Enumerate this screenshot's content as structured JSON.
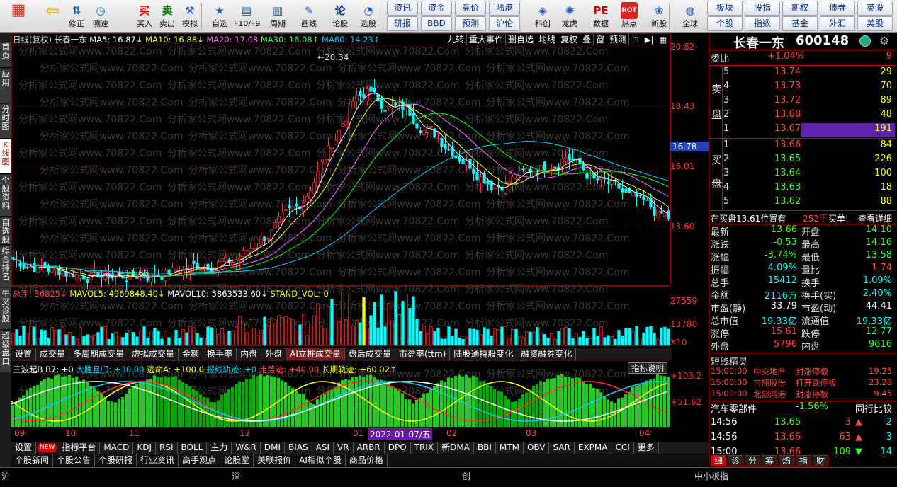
{
  "toolbar": {
    "buttons": [
      {
        "label": "",
        "icon": "home-grid-icon"
      },
      {
        "label": "",
        "icon": "back-arrow-icon"
      },
      {
        "label": "修正",
        "icon": "up-down-icon"
      },
      {
        "label": "测速",
        "icon": "clock-icon"
      },
      {
        "label": "买入",
        "icon": "buy-icon",
        "glyph": "买"
      },
      {
        "label": "卖出",
        "icon": "sell-icon",
        "glyph": "卖"
      },
      {
        "label": "模拟",
        "icon": "gavel-icon"
      },
      {
        "label": "自选",
        "icon": "favorites-icon"
      },
      {
        "label": "F10/F9",
        "icon": "f10-icon"
      },
      {
        "label": "周期",
        "icon": "period-icon"
      },
      {
        "label": "画线",
        "icon": "pen-icon"
      },
      {
        "label": "论股",
        "icon": "discuss-icon",
        "glyph": "论"
      },
      {
        "label": "选股",
        "icon": "select-stock-icon"
      },
      {
        "label": "科创",
        "icon": "kechuang-icon"
      },
      {
        "label": "龙虎",
        "icon": "dragon-tiger-icon"
      },
      {
        "label": "数据",
        "icon": "data-pe-icon",
        "glyph": "PE"
      },
      {
        "label": "热点",
        "icon": "hot-icon",
        "glyph": "HOT"
      },
      {
        "label": "新股",
        "icon": "new-stock-icon"
      },
      {
        "label": "全球",
        "icon": "globe-icon"
      }
    ],
    "mid_buttons": [
      "资讯",
      "资金",
      "竞价",
      "陆港",
      "研报",
      "BBD",
      "预测",
      "沪伦"
    ],
    "right_buttons": [
      "板块",
      "股指",
      "期权",
      "债券",
      "英股",
      "个股",
      "指数",
      "基金",
      "外汇",
      "美股"
    ]
  },
  "left_nav": [
    "首页",
    "应用",
    "分时图",
    "K线图",
    "个股资料",
    "自选股",
    "综合排名",
    "牛叉诊股",
    "超级盘口"
  ],
  "kline": {
    "legend": {
      "name": "日线(复权) 长春一东",
      "ma5": "MA5: 16.87↓",
      "ma10": "MA10: 16.88↓",
      "ma20": "MA20: 17.08",
      "ma30": "MA30: 16.08↑",
      "ma60": "MA60: 14.23↑"
    },
    "tools": [
      "九转",
      "重大事件",
      "删自选",
      "均线",
      "复权",
      "叠",
      "窗",
      "预测"
    ],
    "axis_labels": [
      "20.82",
      "18.43",
      "16.78",
      "16.01",
      "13.60"
    ],
    "current_price": "16.78",
    "high_label": "20.34",
    "low_label": "11.66",
    "watermark": "分析家公式网www.70822.Com",
    "colors": {
      "ma5": "#ffffff",
      "ma10": "#ffff00",
      "ma20": "#ff66ff",
      "ma30": "#00ff00",
      "ma60": "#00ccff",
      "up": "#ff3333",
      "down": "#00ffff"
    }
  },
  "volume": {
    "legend": {
      "total": "总手: 36825↓",
      "mavol5": "MAVOL5: 4969848.40↓",
      "mavol10": "MAVOL10: 5863533.60↓",
      "standvol": "STAND_VOL: 0"
    },
    "axis_labels": [
      "27559",
      "13780",
      "X10"
    ]
  },
  "sub_tabs": [
    "设置",
    "成交量",
    "多周期成交量",
    "虚拟成交量",
    "金额",
    "换手率",
    "内盘",
    "外盘",
    "AI立桩成交量",
    "盘后成交量",
    "市盈率(ttm)",
    "陆股通持股变化",
    "融资融券变化"
  ],
  "indicator": {
    "legend": {
      "name": "三波起B B7: +0",
      "dsqg": "大胜且归: +30.00",
      "tma": "逃命A: +100.0",
      "bxgj": "报线轨迹: +0",
      "zsj": "走势迹: +40.00",
      "cqgj": "长期轨迹: +60.02↑"
    },
    "button": "指标说明",
    "axis_labels": [
      "+103.2",
      "+51.62"
    ]
  },
  "months": [
    "09",
    "10",
    "11",
    "12",
    "01",
    "02",
    "03",
    "04"
  ],
  "date_marker": "2022-01-07/五",
  "indicator_tabs": [
    "设置",
    "NEW",
    "指标平台",
    "MACD",
    "KDJ",
    "RSI",
    "BOLL",
    "主力",
    "W&R",
    "DMI",
    "BIAS",
    "ASI",
    "VR",
    "ARBR",
    "DPO",
    "TRIX",
    "新DMA",
    "BBI",
    "MTM",
    "OBV",
    "SAR",
    "EXPMA",
    "CCI",
    "更多"
  ],
  "bottom_tabs": [
    "个股新闻",
    "个股公告",
    "个股研报",
    "行业资讯",
    "高手观点",
    "论股堂",
    "关联报价",
    "AI相似个股",
    "商品价格"
  ],
  "panel": {
    "stock_name": "长春一东",
    "stock_code": "600148",
    "weibi_label": "委比",
    "weibi_value": "+1.04%",
    "weibi_extra": "9",
    "sell_label": [
      "卖",
      "盘"
    ],
    "buy_label": [
      "买",
      "盘"
    ],
    "sell": [
      {
        "lvl": "5",
        "price": "13.74",
        "vol": "29"
      },
      {
        "lvl": "4",
        "price": "13.73",
        "vol": "70"
      },
      {
        "lvl": "3",
        "price": "13.72",
        "vol": "89"
      },
      {
        "lvl": "2",
        "price": "13.68",
        "vol": "48"
      },
      {
        "lvl": "1",
        "price": "13.67",
        "vol": "191"
      }
    ],
    "buy": [
      {
        "lvl": "1",
        "price": "13.66",
        "vol": "84"
      },
      {
        "lvl": "2",
        "price": "13.65",
        "vol": "226"
      },
      {
        "lvl": "3",
        "price": "13.64",
        "vol": "100"
      },
      {
        "lvl": "4",
        "price": "13.63",
        "vol": "18"
      },
      {
        "lvl": "5",
        "price": "13.62",
        "vol": "88"
      }
    ],
    "buy_notice": {
      "text": "在买盘13.61位置有",
      "qty": "252手",
      "tag": "买单!",
      "link": "查看详细"
    },
    "stats": [
      {
        "l1": "最新",
        "v1": "13.66",
        "c1": "grn",
        "l2": "开盘",
        "v2": "14.10",
        "c2": "grn"
      },
      {
        "l1": "涨跌",
        "v1": "-0.53",
        "c1": "grn",
        "l2": "最高",
        "v2": "14.16",
        "c2": "grn"
      },
      {
        "l1": "涨幅",
        "v1": "-3.74%",
        "c1": "grn",
        "l2": "最低",
        "v2": "13.58",
        "c2": "grn"
      },
      {
        "l1": "振幅",
        "v1": "4.09%",
        "c1": "cyn",
        "l2": "量比",
        "v2": "1.74",
        "c2": "red"
      },
      {
        "l1": "总手",
        "v1": "15412",
        "c1": "cyn",
        "l2": "换手",
        "v2": "1.09%",
        "c2": "cyn"
      },
      {
        "l1": "金额",
        "v1": "2116万",
        "c1": "cyn",
        "l2": "换手(实)",
        "v2": "2.40%",
        "c2": "cyn"
      },
      {
        "l1": "市盈(静)",
        "v1": "33.79",
        "c1": "wht",
        "l2": "市盈(动)",
        "v2": "44.41",
        "c2": "wht"
      },
      {
        "l1": "总市值",
        "v1": "19.33亿",
        "c1": "cyn",
        "l2": "流通值",
        "v2": "19.33亿",
        "c2": "cyn"
      },
      {
        "l1": "涨停",
        "v1": "15.61",
        "c1": "red",
        "l2": "跌停",
        "v2": "12.77",
        "c2": "grn"
      },
      {
        "l1": "外盘",
        "v1": "5796",
        "c1": "red",
        "l2": "内盘",
        "v2": "9616",
        "c2": "grn"
      }
    ],
    "short_title": "短线精灵",
    "short_list": [
      {
        "time": "15:00:00",
        "name": "中交地产",
        "event": "封涨停板",
        "val": "19.25"
      },
      {
        "time": "15:00:00",
        "name": "吉翔股份",
        "event": "打开跌停板",
        "val": "23.28"
      },
      {
        "time": "15:00:00",
        "name": "北部湾港",
        "event": "封涨停板",
        "val": "9.45"
      }
    ],
    "sector_name": "汽车零部件",
    "sector_change": "-1.56%",
    "sector_link": "同行比较",
    "ticks": [
      {
        "time": "14:56",
        "price": "13.65",
        "vol": "3",
        "dir": "up",
        "n": "2"
      },
      {
        "time": "14:56",
        "price": "13.66",
        "vol": "63",
        "dir": "up",
        "n": "3"
      },
      {
        "time": "15:00",
        "price": "13.66",
        "vol": "109",
        "dir": "down",
        "n": "14"
      }
    ],
    "tabs": [
      "细",
      "诊",
      "分",
      "筹",
      "焰",
      "指",
      "财"
    ]
  },
  "statusbar": {
    "sh": "沪",
    "sz": "深",
    "cy": "创",
    "index": "中小板指"
  }
}
